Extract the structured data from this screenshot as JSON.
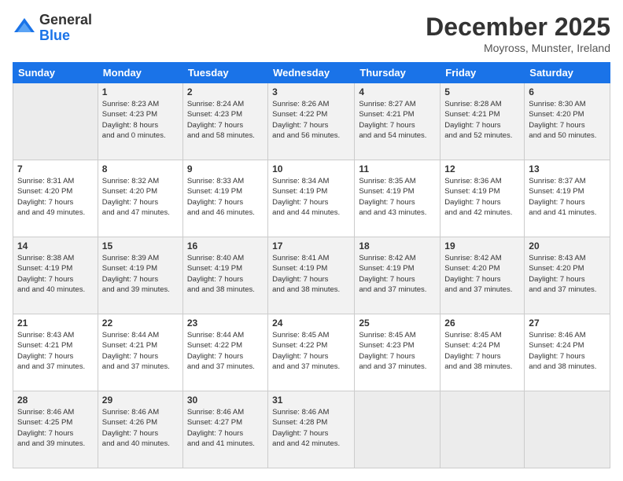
{
  "logo": {
    "general": "General",
    "blue": "Blue"
  },
  "header": {
    "month": "December 2025",
    "location": "Moyross, Munster, Ireland"
  },
  "weekdays": [
    "Sunday",
    "Monday",
    "Tuesday",
    "Wednesday",
    "Thursday",
    "Friday",
    "Saturday"
  ],
  "weeks": [
    [
      {
        "day": "",
        "sunrise": "",
        "sunset": "",
        "daylight": ""
      },
      {
        "day": "1",
        "sunrise": "Sunrise: 8:23 AM",
        "sunset": "Sunset: 4:23 PM",
        "daylight": "Daylight: 8 hours and 0 minutes."
      },
      {
        "day": "2",
        "sunrise": "Sunrise: 8:24 AM",
        "sunset": "Sunset: 4:23 PM",
        "daylight": "Daylight: 7 hours and 58 minutes."
      },
      {
        "day": "3",
        "sunrise": "Sunrise: 8:26 AM",
        "sunset": "Sunset: 4:22 PM",
        "daylight": "Daylight: 7 hours and 56 minutes."
      },
      {
        "day": "4",
        "sunrise": "Sunrise: 8:27 AM",
        "sunset": "Sunset: 4:21 PM",
        "daylight": "Daylight: 7 hours and 54 minutes."
      },
      {
        "day": "5",
        "sunrise": "Sunrise: 8:28 AM",
        "sunset": "Sunset: 4:21 PM",
        "daylight": "Daylight: 7 hours and 52 minutes."
      },
      {
        "day": "6",
        "sunrise": "Sunrise: 8:30 AM",
        "sunset": "Sunset: 4:20 PM",
        "daylight": "Daylight: 7 hours and 50 minutes."
      }
    ],
    [
      {
        "day": "7",
        "sunrise": "Sunrise: 8:31 AM",
        "sunset": "Sunset: 4:20 PM",
        "daylight": "Daylight: 7 hours and 49 minutes."
      },
      {
        "day": "8",
        "sunrise": "Sunrise: 8:32 AM",
        "sunset": "Sunset: 4:20 PM",
        "daylight": "Daylight: 7 hours and 47 minutes."
      },
      {
        "day": "9",
        "sunrise": "Sunrise: 8:33 AM",
        "sunset": "Sunset: 4:19 PM",
        "daylight": "Daylight: 7 hours and 46 minutes."
      },
      {
        "day": "10",
        "sunrise": "Sunrise: 8:34 AM",
        "sunset": "Sunset: 4:19 PM",
        "daylight": "Daylight: 7 hours and 44 minutes."
      },
      {
        "day": "11",
        "sunrise": "Sunrise: 8:35 AM",
        "sunset": "Sunset: 4:19 PM",
        "daylight": "Daylight: 7 hours and 43 minutes."
      },
      {
        "day": "12",
        "sunrise": "Sunrise: 8:36 AM",
        "sunset": "Sunset: 4:19 PM",
        "daylight": "Daylight: 7 hours and 42 minutes."
      },
      {
        "day": "13",
        "sunrise": "Sunrise: 8:37 AM",
        "sunset": "Sunset: 4:19 PM",
        "daylight": "Daylight: 7 hours and 41 minutes."
      }
    ],
    [
      {
        "day": "14",
        "sunrise": "Sunrise: 8:38 AM",
        "sunset": "Sunset: 4:19 PM",
        "daylight": "Daylight: 7 hours and 40 minutes."
      },
      {
        "day": "15",
        "sunrise": "Sunrise: 8:39 AM",
        "sunset": "Sunset: 4:19 PM",
        "daylight": "Daylight: 7 hours and 39 minutes."
      },
      {
        "day": "16",
        "sunrise": "Sunrise: 8:40 AM",
        "sunset": "Sunset: 4:19 PM",
        "daylight": "Daylight: 7 hours and 38 minutes."
      },
      {
        "day": "17",
        "sunrise": "Sunrise: 8:41 AM",
        "sunset": "Sunset: 4:19 PM",
        "daylight": "Daylight: 7 hours and 38 minutes."
      },
      {
        "day": "18",
        "sunrise": "Sunrise: 8:42 AM",
        "sunset": "Sunset: 4:19 PM",
        "daylight": "Daylight: 7 hours and 37 minutes."
      },
      {
        "day": "19",
        "sunrise": "Sunrise: 8:42 AM",
        "sunset": "Sunset: 4:20 PM",
        "daylight": "Daylight: 7 hours and 37 minutes."
      },
      {
        "day": "20",
        "sunrise": "Sunrise: 8:43 AM",
        "sunset": "Sunset: 4:20 PM",
        "daylight": "Daylight: 7 hours and 37 minutes."
      }
    ],
    [
      {
        "day": "21",
        "sunrise": "Sunrise: 8:43 AM",
        "sunset": "Sunset: 4:21 PM",
        "daylight": "Daylight: 7 hours and 37 minutes."
      },
      {
        "day": "22",
        "sunrise": "Sunrise: 8:44 AM",
        "sunset": "Sunset: 4:21 PM",
        "daylight": "Daylight: 7 hours and 37 minutes."
      },
      {
        "day": "23",
        "sunrise": "Sunrise: 8:44 AM",
        "sunset": "Sunset: 4:22 PM",
        "daylight": "Daylight: 7 hours and 37 minutes."
      },
      {
        "day": "24",
        "sunrise": "Sunrise: 8:45 AM",
        "sunset": "Sunset: 4:22 PM",
        "daylight": "Daylight: 7 hours and 37 minutes."
      },
      {
        "day": "25",
        "sunrise": "Sunrise: 8:45 AM",
        "sunset": "Sunset: 4:23 PM",
        "daylight": "Daylight: 7 hours and 37 minutes."
      },
      {
        "day": "26",
        "sunrise": "Sunrise: 8:45 AM",
        "sunset": "Sunset: 4:24 PM",
        "daylight": "Daylight: 7 hours and 38 minutes."
      },
      {
        "day": "27",
        "sunrise": "Sunrise: 8:46 AM",
        "sunset": "Sunset: 4:24 PM",
        "daylight": "Daylight: 7 hours and 38 minutes."
      }
    ],
    [
      {
        "day": "28",
        "sunrise": "Sunrise: 8:46 AM",
        "sunset": "Sunset: 4:25 PM",
        "daylight": "Daylight: 7 hours and 39 minutes."
      },
      {
        "day": "29",
        "sunrise": "Sunrise: 8:46 AM",
        "sunset": "Sunset: 4:26 PM",
        "daylight": "Daylight: 7 hours and 40 minutes."
      },
      {
        "day": "30",
        "sunrise": "Sunrise: 8:46 AM",
        "sunset": "Sunset: 4:27 PM",
        "daylight": "Daylight: 7 hours and 41 minutes."
      },
      {
        "day": "31",
        "sunrise": "Sunrise: 8:46 AM",
        "sunset": "Sunset: 4:28 PM",
        "daylight": "Daylight: 7 hours and 42 minutes."
      },
      {
        "day": "",
        "sunrise": "",
        "sunset": "",
        "daylight": ""
      },
      {
        "day": "",
        "sunrise": "",
        "sunset": "",
        "daylight": ""
      },
      {
        "day": "",
        "sunrise": "",
        "sunset": "",
        "daylight": ""
      }
    ]
  ]
}
